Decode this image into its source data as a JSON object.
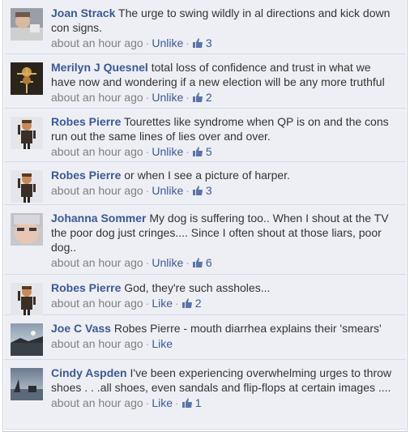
{
  "comments": [
    {
      "author": "Joan Strack",
      "text": "The urge to swing wildly in al directions and kick down con signs.",
      "time": "about an hour ago",
      "action": "Unlike",
      "likes": "3",
      "avatar": "joan-strack-avatar"
    },
    {
      "author": "Merilyn J Quesnel",
      "text": "total loss of confidence and trust in what we have now and wondering if a new election will be any more truthful",
      "time": "about an hour ago",
      "action": "Unlike",
      "likes": "2",
      "avatar": "merilyn-quesnel-avatar"
    },
    {
      "author": "Robes Pierre",
      "text": "Tourettes like syndrome when QP is on and the cons run out the same lines of lies over and over.",
      "time": "about an hour ago",
      "action": "Unlike",
      "likes": "5",
      "avatar": "robes-pierre-avatar"
    },
    {
      "author": "Robes Pierre",
      "text": "or when I see a picture of harper.",
      "time": "about an hour ago",
      "action": "Unlike",
      "likes": "3",
      "avatar": "robes-pierre-avatar"
    },
    {
      "author": "Johanna Sommer",
      "text": "My dog is suffering too.. When I shout at the TV the poor dog just cringes.... Since I often shout at those liars, poor dog..",
      "time": "about an hour ago",
      "action": "Unlike",
      "likes": "6",
      "avatar": "johanna-sommer-avatar"
    },
    {
      "author": "Robes Pierre",
      "text": "God, they're such assholes...",
      "time": "about an hour ago",
      "action": "Like",
      "likes": "2",
      "avatar": "robes-pierre-avatar"
    },
    {
      "author": "Joe C Vass",
      "text": "Robes Pierre - mouth diarrhea explains their 'smears'",
      "time": "about an hour ago",
      "action": "Like",
      "likes": "",
      "avatar": "joe-vass-avatar"
    },
    {
      "author": "Cindy Aspden",
      "text": "I've been experiencing overwhelming urges to throw shoes . . .all shoes, even sandals and flip-flops at certain images ....",
      "time": "about an hour ago",
      "action": "Like",
      "likes": "1",
      "avatar": "cindy-aspden-avatar"
    }
  ],
  "separator": "·",
  "colors": {
    "link": "#3b5998",
    "meta": "#808080",
    "background": "#edeff4",
    "text": "#333333"
  },
  "icons": {
    "like": "thumbs-up-icon"
  }
}
